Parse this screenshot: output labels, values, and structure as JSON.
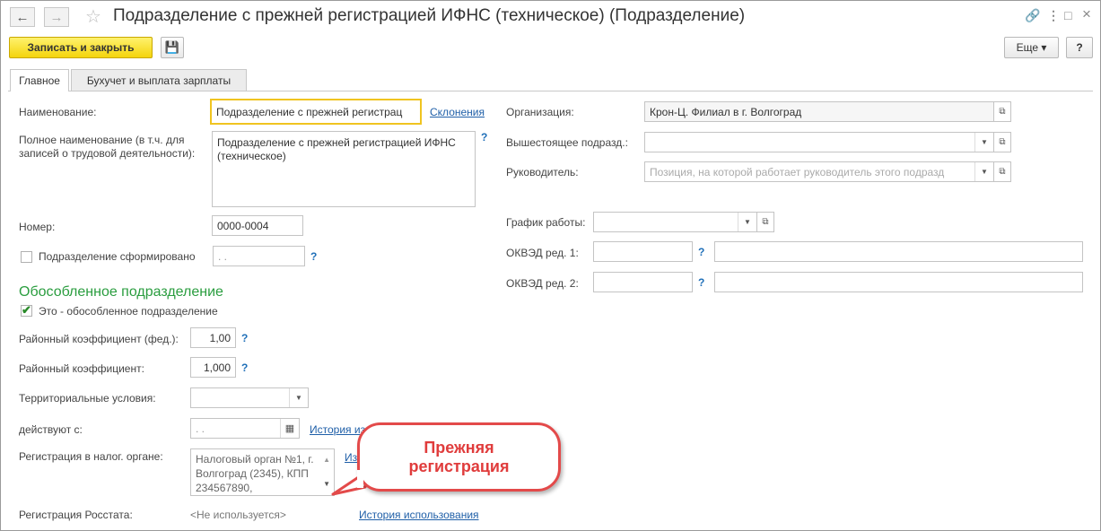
{
  "window": {
    "title": "Подразделение с прежней регистрацией ИФНС (техническое) (Подразделение)",
    "back_icon": "←",
    "forward_icon": "→",
    "favorite_icon": "☆",
    "link_icon": "🔗",
    "menu_icon": "⋮",
    "restore_icon": "□",
    "close_icon": "×"
  },
  "toolbar": {
    "save_close_label": "Записать и закрыть",
    "save_icon": "💾",
    "more_label": "Еще ▾",
    "help_label": "?"
  },
  "tabs": [
    {
      "label": "Главное"
    },
    {
      "label": "Бухучет и выплата зарплаты"
    }
  ],
  "left": {
    "name_label": "Наименование:",
    "name_value": "Подразделение с прежней регистрац",
    "declension_link": "Склонения",
    "fullname_label": "Полное наименование (в т.ч. для записей о трудовой деятельности):",
    "fullname_value": "Подразделение с прежней регистрацией ИФНС (техническое)",
    "number_label": "Номер:",
    "number_value": "0000-0004",
    "formed_label": "Подразделение сформировано",
    "formed_date": " .  .",
    "separate_section": "Обособленное подразделение",
    "is_separate_label": "Это - обособленное подразделение",
    "is_separate_check": "✔",
    "reg_coef_fed_label": "Районный коэффициент (фед.):",
    "reg_coef_fed_value": "1,00",
    "reg_coef_label": "Районный коэффициент:",
    "reg_coef_value": "1,000",
    "territorial_label": "Территориальные условия:",
    "territorial_value": "",
    "valid_from_label": "действуют с:",
    "valid_from_value": " .  .",
    "history_change_link": "История из",
    "tax_reg_label": "Регистрация в налог. органе:",
    "tax_reg_value": "Налоговый орган №1, г. Волгоград (2345), КПП 234567890,",
    "tax_reg_link": "Из",
    "rosstat_label": "Регистрация Росстата:",
    "rosstat_value": "<Не используется>",
    "rosstat_link": "История использования",
    "help": "?"
  },
  "right": {
    "org_label": "Организация:",
    "org_value": "Крон-Ц. Филиал в г. Волгоград",
    "parent_label": "Вышестоящее подразд.:",
    "parent_value": "",
    "head_label": "Руководитель:",
    "head_placeholder": "Позиция, на которой работает руководитель этого подразд",
    "schedule_label": "График работы:",
    "schedule_value": "",
    "okved1_label": "ОКВЭД ред. 1:",
    "okved2_label": "ОКВЭД ред. 2:"
  },
  "callout": {
    "text_line1": "Прежняя",
    "text_line2": "регистрация"
  }
}
